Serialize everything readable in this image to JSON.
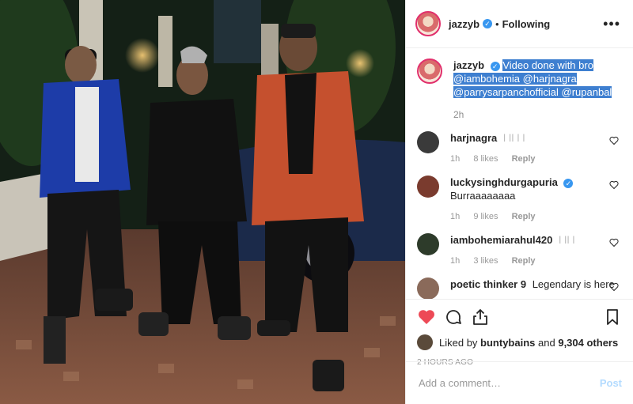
{
  "header": {
    "username": "jazzyb",
    "separator": "•",
    "follow_status": "Following",
    "more_icon": "more-options-icon"
  },
  "caption": {
    "username": "jazzyb",
    "text_line1": "Video done with bro",
    "text_line2": "@iambohemia @harjnagra",
    "text_line3": "@parrysarpanchofficial @rupanbal",
    "age": "2h"
  },
  "comments": [
    {
      "username": "harjnagra",
      "text": "ǀ ǀǀ ǀ ǀ",
      "age": "1h",
      "likes": "8 likes",
      "reply": "Reply",
      "avatar_color": "#3a3a3a"
    },
    {
      "username": "luckysinghdurgapuria",
      "text": "Burraaaaaaaa",
      "age": "1h",
      "likes": "9 likes",
      "reply": "Reply",
      "avatar_color": "#7a3b2e",
      "verified": true
    },
    {
      "username": "iambohemiarahul420",
      "text": "ǀ ǀǀ ǀ",
      "age": "1h",
      "likes": "3 likes",
      "reply": "Reply",
      "avatar_color": "#2d3b2a"
    },
    {
      "username": "poetic thinker 9",
      "text": "Legendary is here",
      "avatar_color": "#8a6a5a"
    }
  ],
  "actions": {
    "like_icon": "heart-filled-icon",
    "comment_icon": "comment-icon",
    "share_icon": "share-icon",
    "save_icon": "bookmark-icon",
    "like_color": "#ed4956"
  },
  "likes": {
    "prefix": "Liked by",
    "user": "buntybains",
    "middle": "and",
    "count": "9,304 others"
  },
  "timestamp": "2 HOURS AGO",
  "add_comment": {
    "placeholder": "Add a comment…",
    "post_label": "Post"
  }
}
